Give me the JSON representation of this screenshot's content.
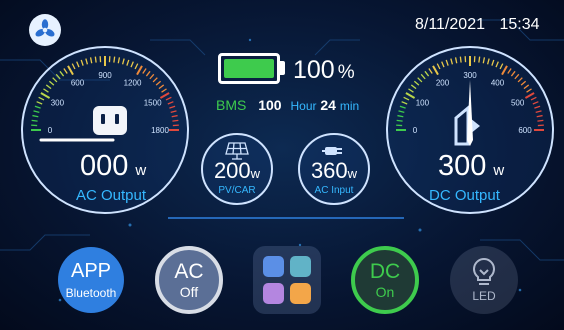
{
  "status": {
    "date": "8/11/2021",
    "time": "15:34"
  },
  "battery": {
    "percent": "100",
    "percent_unit": "%",
    "level": 1.0,
    "color": "#3ecb4d"
  },
  "bms": {
    "label": "BMS",
    "hours": "100",
    "hour_label": "Hour",
    "minutes": "24",
    "min_label": "min"
  },
  "ac_gauge": {
    "ticks": [
      "0",
      "300",
      "600",
      "900",
      "1200",
      "1500",
      "1800"
    ],
    "value": "000",
    "unit": "w",
    "label": "AC Output",
    "level": 0
  },
  "dc_gauge": {
    "ticks": [
      "0",
      "100",
      "200",
      "300",
      "400",
      "500",
      "600"
    ],
    "value": "300",
    "unit": "w",
    "label": "DC Output",
    "level": 0.5
  },
  "pv": {
    "value": "200",
    "unit": "w",
    "label": "PV/CAR"
  },
  "ac_input": {
    "value": "360",
    "unit": "w",
    "label": "AC Input"
  },
  "buttons": {
    "app": {
      "title": "APP",
      "sub": "Bluetooth"
    },
    "ac": {
      "title": "AC",
      "sub": "Off"
    },
    "dc": {
      "title": "DC",
      "sub": "On"
    },
    "led": {
      "label": "LED"
    }
  },
  "colors": {
    "accent": "#35b8ff",
    "on": "#3ecb4d",
    "app_button": "#2f7fe0",
    "tile_blue": "#5b8fe6",
    "tile_teal": "#61b3c7",
    "tile_purple": "#b486e0",
    "tile_orange": "#f3a649"
  }
}
